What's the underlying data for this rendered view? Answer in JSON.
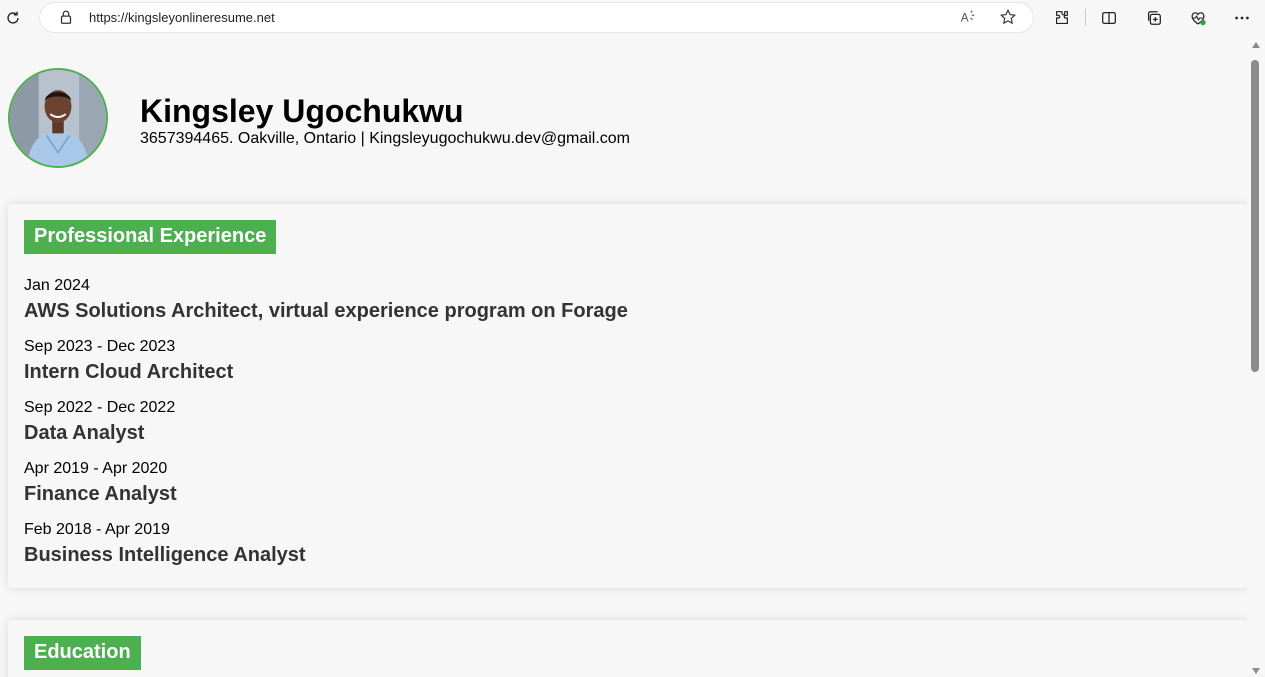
{
  "browser": {
    "url": "https://kingsleyonlineresume.net"
  },
  "header": {
    "name": "Kingsley Ugochukwu",
    "contact": "3657394465. Oakville, Ontario | Kingsleyugochukwu.dev@gmail.com"
  },
  "experience": {
    "title": "Professional Experience",
    "items": [
      {
        "date": "Jan 2024",
        "role": "AWS Solutions Architect, virtual experience program on Forage"
      },
      {
        "date": "Sep 2023 - Dec 2023",
        "role": "Intern Cloud Architect"
      },
      {
        "date": "Sep 2022 - Dec 2022",
        "role": "Data Analyst"
      },
      {
        "date": "Apr 2019 - Apr 2020",
        "role": "Finance Analyst"
      },
      {
        "date": "Feb 2018 - Apr 2019",
        "role": "Business Intelligence Analyst"
      }
    ]
  },
  "education": {
    "title": "Education"
  },
  "colors": {
    "accent": "#4caf50",
    "page_bg": "#f7f7f7"
  }
}
